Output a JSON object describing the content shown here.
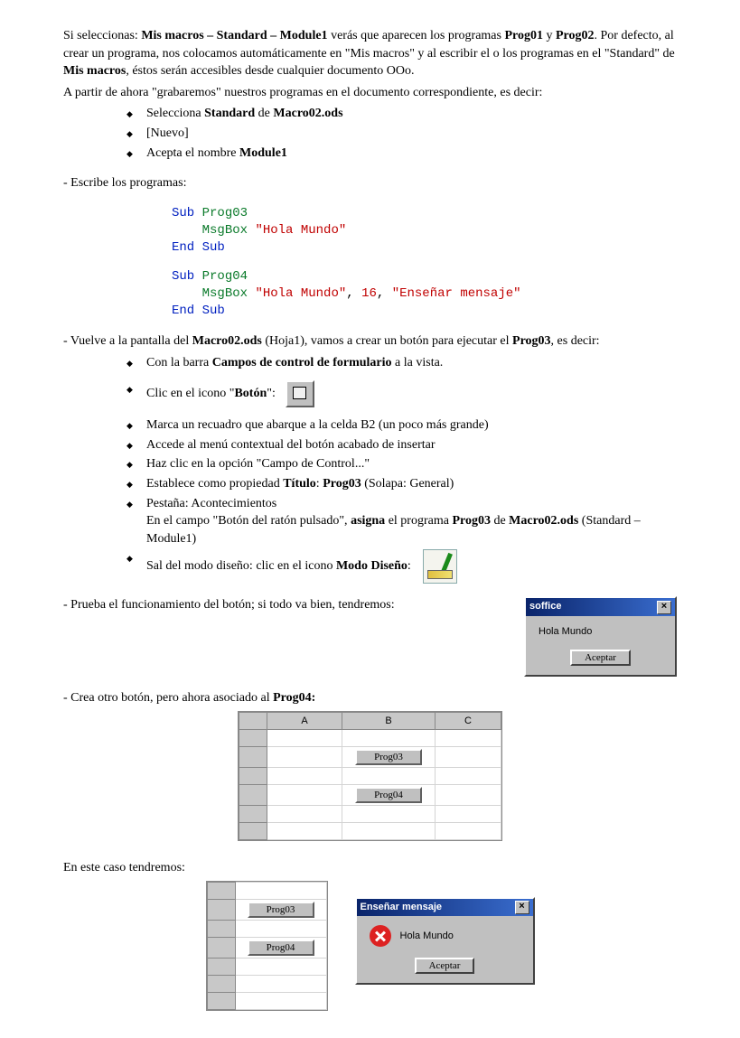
{
  "intro": {
    "p1a": "Si seleccionas: ",
    "p1b": "Mis macros – Standard – Module1",
    "p1c": " verás que aparecen los programas ",
    "p1d": "Prog01",
    "p1e": " y ",
    "p2a": "Prog02",
    "p2b": ". Por defecto, al crear un programa, nos colocamos automáticamente en \"Mis macros\" y al escribir el o los programas en el \"Standard\" de ",
    "p2c": "Mis macros",
    "p2d": ", éstos serán accesibles desde cualquier documento OOo.",
    "p3": "A partir de ahora \"grabaremos\" nuestros programas en el documento correspondiente, es decir:"
  },
  "list1": {
    "i1a": "Selecciona ",
    "i1b": "Standard",
    "i1c": " de ",
    "i1d": "Macro02.ods",
    "i2": "[Nuevo]",
    "i3a": "Acepta el nombre ",
    "i3b": "Module1"
  },
  "write_prog": "- Escribe los programas:",
  "code": {
    "sub": "Sub",
    "end": "End",
    "msgbox": "MsgBox",
    "p3": "Prog03",
    "p4": "Prog04",
    "hola": "\"Hola Mundo\"",
    "num": "16",
    "ens": "\"Enseñar mensaje\""
  },
  "vuelve": {
    "a": "- Vuelve a la pantalla del ",
    "b": "Macro02.ods",
    "c": " (Hoja1), vamos a crear un botón para ejecutar el ",
    "d": "Prog03",
    "e": ", es decir:"
  },
  "list2": {
    "i1a": "Con la barra ",
    "i1b": "Campos de control de formulario",
    "i1c": " a la vista.",
    "i2a": "Clic en el icono \"",
    "i2b": "Botón",
    "i2c": "\":",
    "i3": "Marca un recuadro que abarque a la celda B2 (un poco más grande)",
    "i4": "Accede al menú contextual del botón acabado de insertar",
    "i5": "Haz clic en la opción \"Campo de Control...\"",
    "i6a": "Establece como propiedad ",
    "i6b": "Título",
    "i6c": ": ",
    "i6d": "Prog03",
    "i6e": " (Solapa: General)",
    "i7": "Pestaña: Acontecimientos",
    "i7ba": "En el campo \"Botón del ratón pulsado\", ",
    "i7bb": "asigna",
    "i7bc": " el programa ",
    "i7bd": "Prog03",
    "i7be": " de ",
    "i7bf": "Macro02.ods",
    "i7bg": " (Standard – Module1)",
    "i8a": "Sal del modo diseño: clic en el icono ",
    "i8b": "Modo Diseño",
    "i8c": ":"
  },
  "prueba": "- Prueba el funcionamiento del botón; si todo va bien, tendremos:",
  "dlg1": {
    "title": "soffice",
    "text": "Hola Mundo",
    "ok": "Aceptar"
  },
  "crea": {
    "a": "- Crea otro botón, pero ahora asociado al ",
    "b": "Prog04:"
  },
  "sheet": {
    "A": "A",
    "B": "B",
    "C": "C",
    "b1": "Prog03",
    "b2": "Prog04"
  },
  "caso": "En este caso tendremos:",
  "dlg2": {
    "title": "Enseñar mensaje",
    "text": "Hola Mundo",
    "ok": "Aceptar"
  },
  "sheet2": {
    "b1": "Prog03",
    "b2": "Prog04"
  }
}
